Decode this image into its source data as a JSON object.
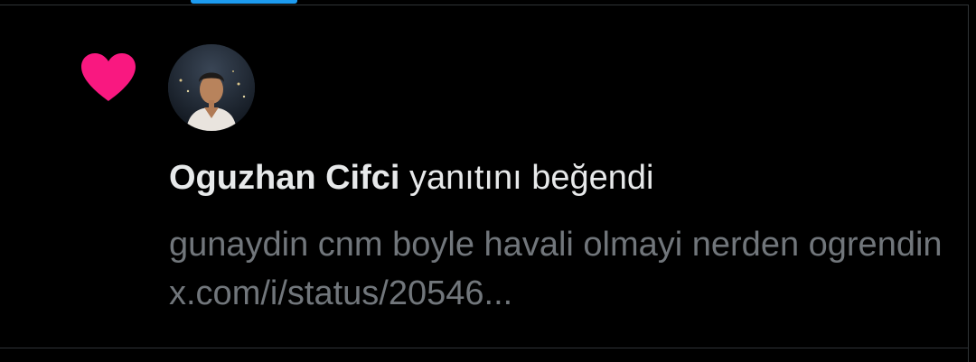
{
  "notification": {
    "type_icon": "heart-icon",
    "user_name": "Oguzhan Cifci",
    "action_text": "yanıtını beğendi",
    "tweet_preview": "gunaydin cnm boyle havali olmayi nerden ogrendin x.com/i/status/20546..."
  },
  "colors": {
    "background": "#000000",
    "like_pink": "#f91880",
    "primary_text": "#e7e9ea",
    "secondary_text": "#71767b",
    "accent_blue": "#1d9bf0",
    "divider": "#2f3336"
  }
}
